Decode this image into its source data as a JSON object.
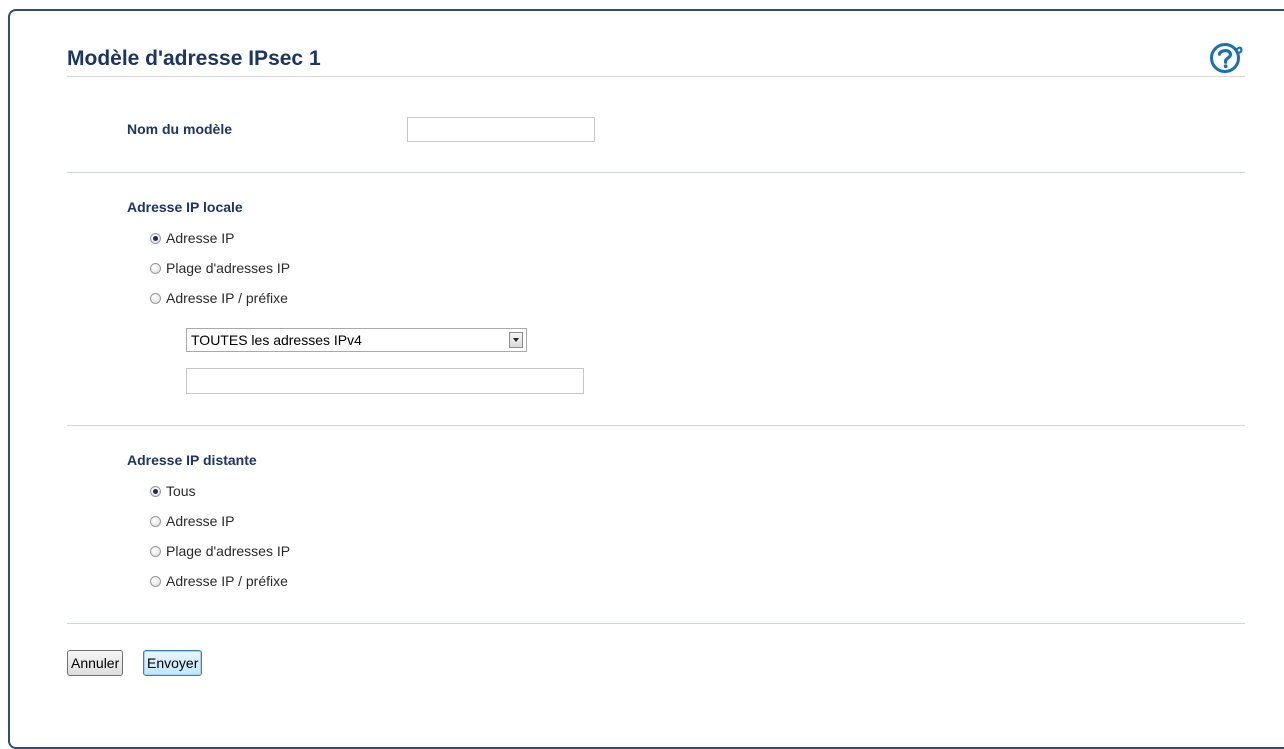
{
  "page": {
    "title": "Modèle d'adresse IPsec 1"
  },
  "icons": {
    "help": "help-icon",
    "dropdown": "chevron-down-icon"
  },
  "colors": {
    "title": "#1c3566",
    "frame_border": "#27507f",
    "help_icon": "#1a6fb5"
  },
  "template_name": {
    "label": "Nom du modèle",
    "value": ""
  },
  "local_ip": {
    "heading": "Adresse IP locale",
    "options": [
      {
        "label": "Adresse IP",
        "checked": true
      },
      {
        "label": "Plage d'adresses IP",
        "checked": false
      },
      {
        "label": "Adresse IP / préfixe",
        "checked": false
      }
    ],
    "address_select": {
      "selected": "TOUTES les adresses IPv4"
    },
    "address_value": ""
  },
  "remote_ip": {
    "heading": "Adresse IP distante",
    "options": [
      {
        "label": "Tous",
        "checked": true
      },
      {
        "label": "Adresse IP",
        "checked": false
      },
      {
        "label": "Plage d'adresses IP",
        "checked": false
      },
      {
        "label": "Adresse IP / préfixe",
        "checked": false
      }
    ]
  },
  "actions": {
    "cancel_label": "Annuler",
    "submit_label": "Envoyer"
  }
}
